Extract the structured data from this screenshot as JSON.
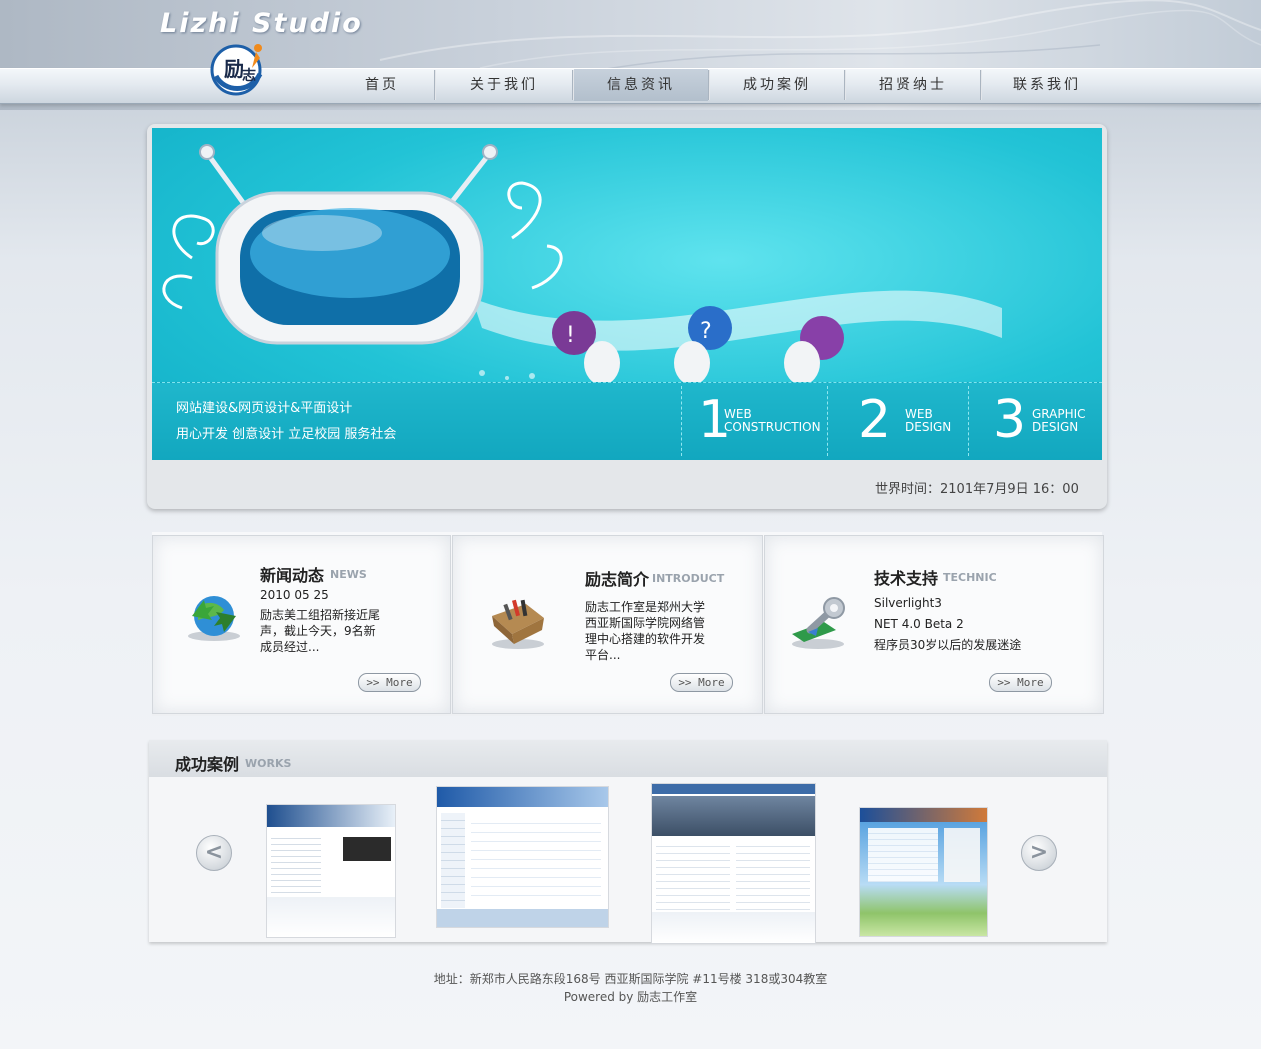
{
  "header": {
    "logo_text": "Lizhi Studio",
    "nav": [
      "首页",
      "关于我们",
      "信息资讯",
      "成功案例",
      "招贤纳士",
      "联系我们"
    ],
    "active_index": 2
  },
  "banner": {
    "line1": "网站建设&网页设计&平面设计",
    "line2": "用心开发  创意设计  立足校园  服务社会",
    "services": [
      {
        "num": "1",
        "label1": "WEB",
        "label2": "CONSTRUCTION"
      },
      {
        "num": "2",
        "label1": "WEB",
        "label2": "DESIGN"
      },
      {
        "num": "3",
        "label1": "GRAPHIC",
        "label2": "DESIGN"
      }
    ],
    "world_time": "世界时间：2101年7月9日 16：00"
  },
  "boxes": [
    {
      "title": "新闻动态",
      "subtitle": "NEWS",
      "lines": [
        "2010 05 25",
        "励志美工组招新接近尾",
        "声，截止今天，9名新",
        "成员经过..."
      ],
      "more": ">> More",
      "icon": "globe-arrows-icon"
    },
    {
      "title": "励志简介",
      "subtitle": "INTRODUCT",
      "lines": [
        "励志工作室是郑州大学",
        "西亚斯国际学院网络管",
        "理中心搭建的软件开发",
        "平台..."
      ],
      "more": ">> More",
      "icon": "toolbox-icon"
    },
    {
      "title": "技术支持",
      "subtitle": "TECHNIC",
      "lines": [
        "Silverlight3",
        "NET 4.0 Beta 2",
        "程序员30岁以后的发展迷途"
      ],
      "more": ">> More",
      "icon": "wrench-icon"
    }
  ],
  "works": {
    "title": "成功案例",
    "subtitle": "WORKS",
    "prev": "<",
    "next": ">"
  },
  "footer": {
    "address": "地址：新郑市人民路东段168号  西亚斯国际学院  #11号楼 318或304教室",
    "powered": "Powered by 励志工作室"
  },
  "colors": {
    "banner": "#22c3d6",
    "nav_active": "#b8c4d0"
  }
}
